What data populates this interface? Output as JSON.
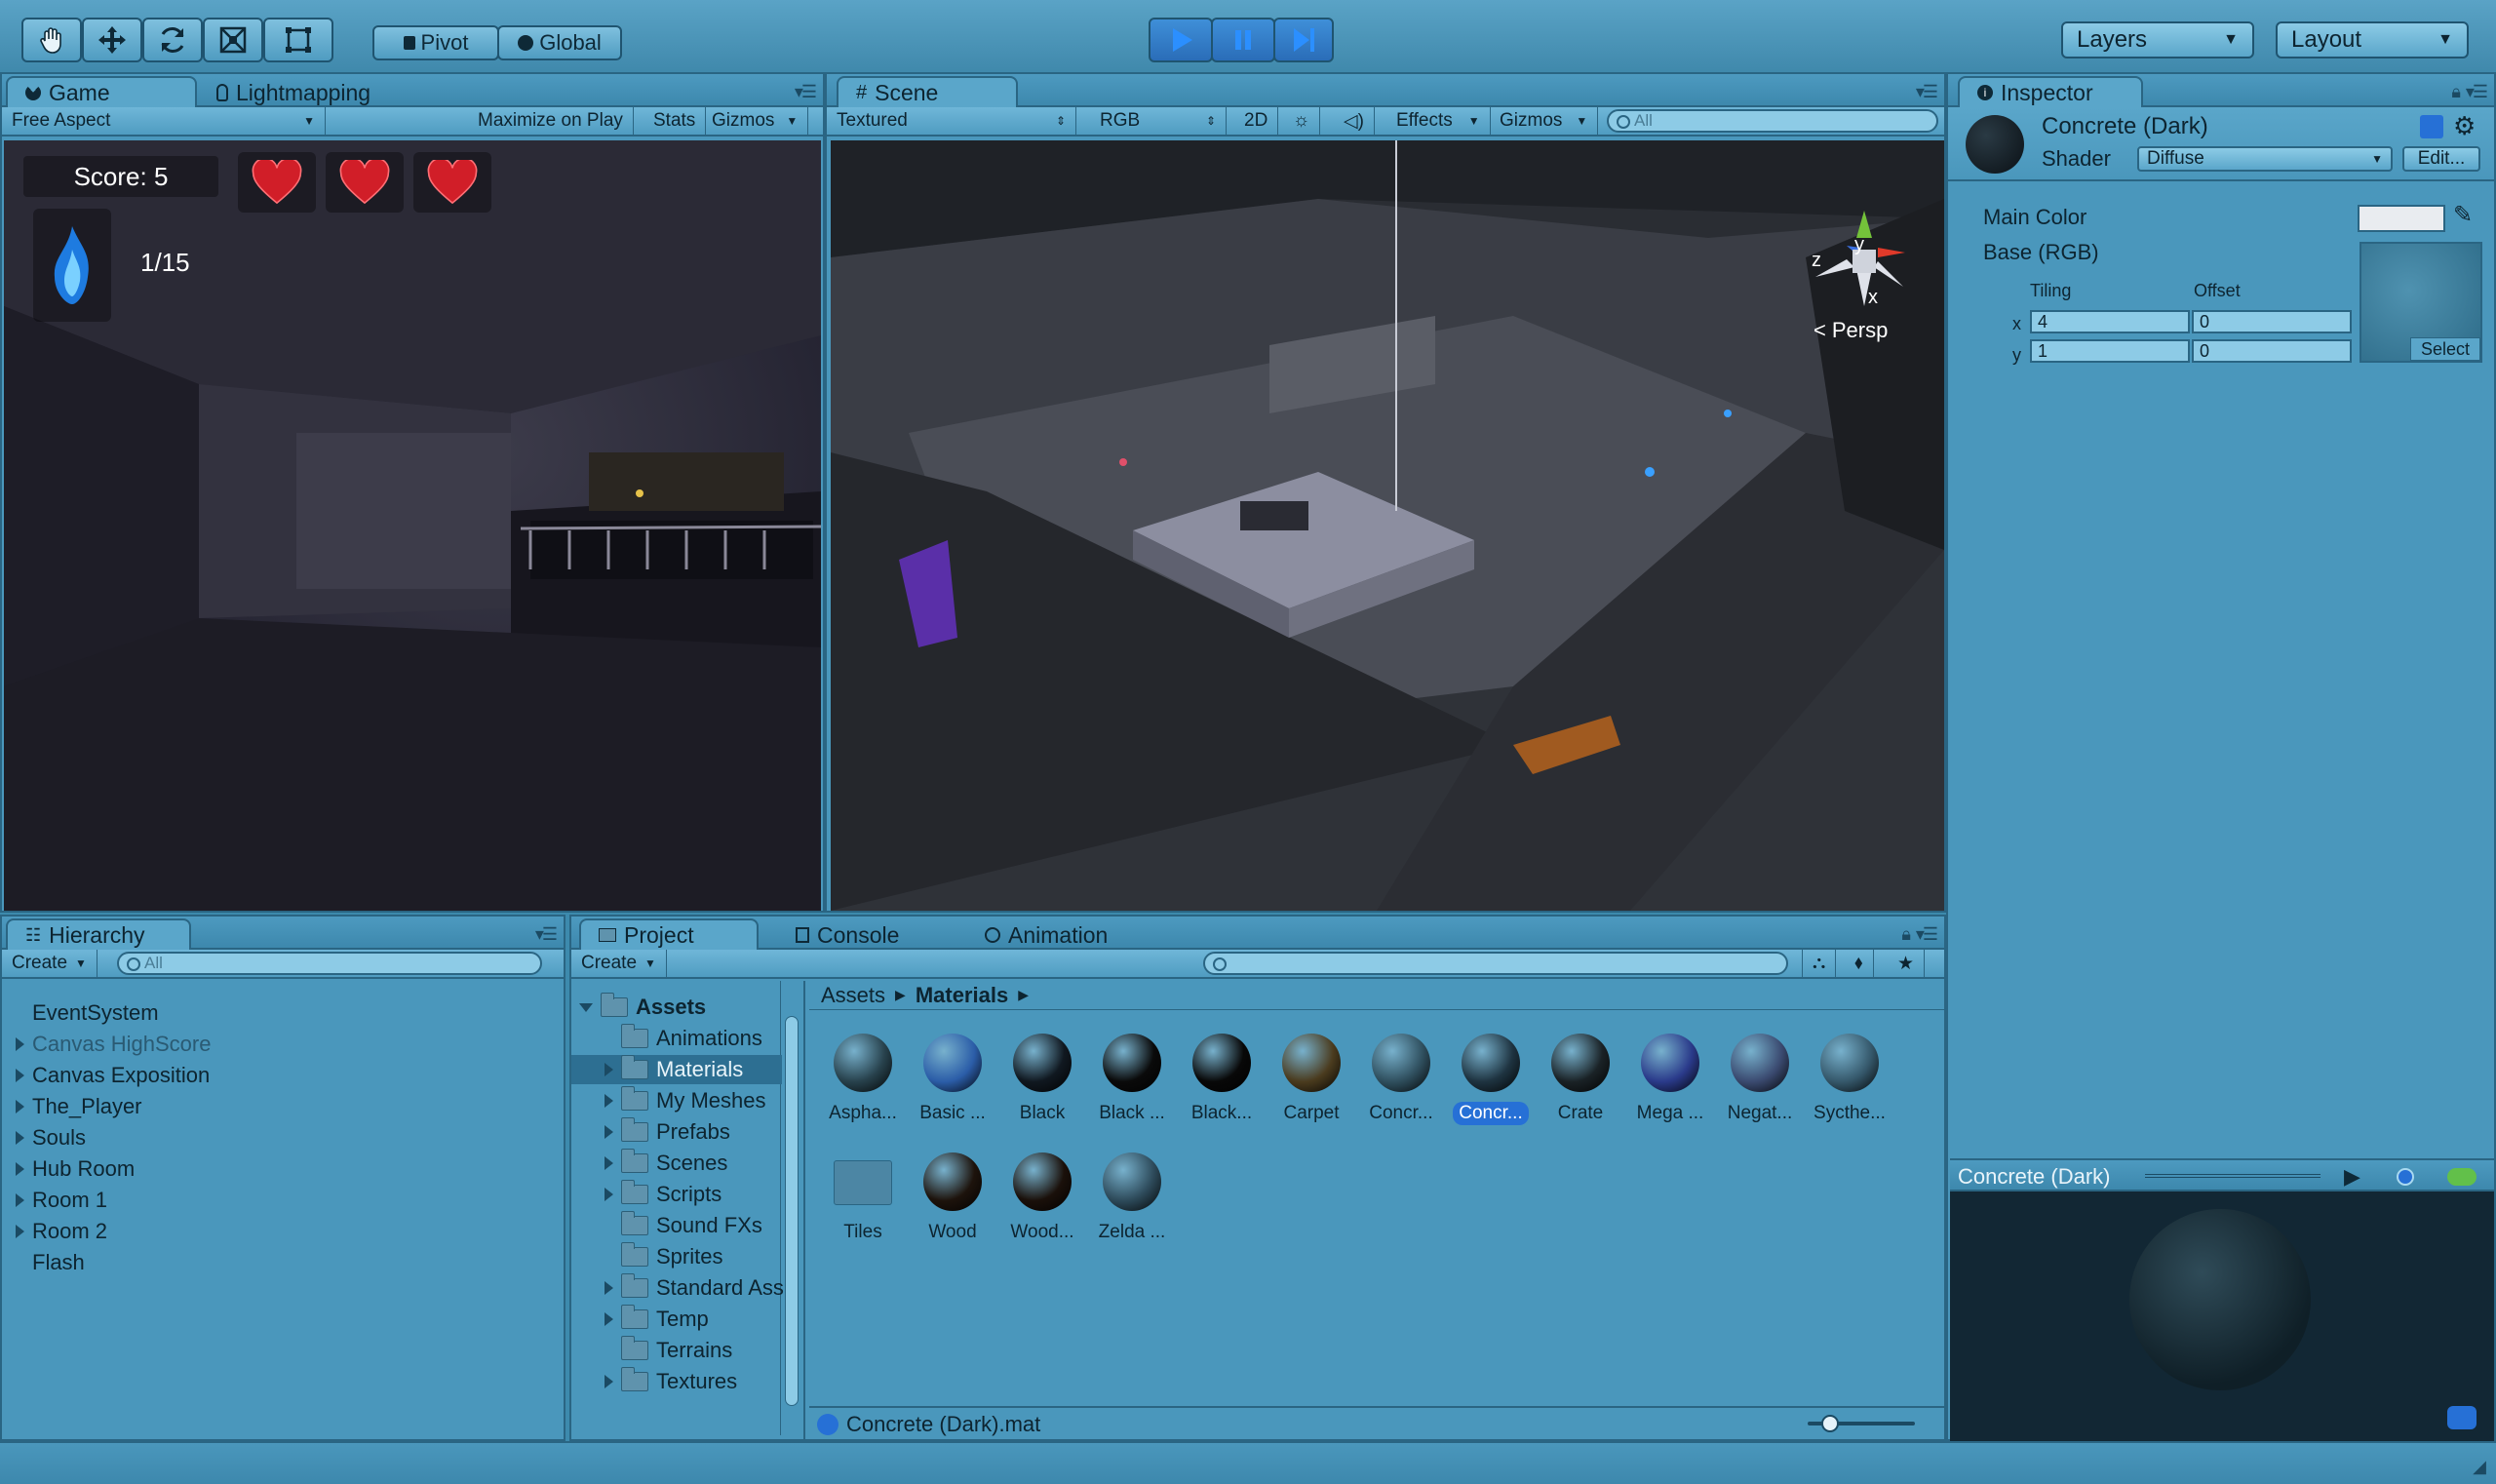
{
  "toolbar": {
    "pivot_label": "Pivot",
    "global_label": "Global",
    "layers_label": "Layers",
    "layout_label": "Layout"
  },
  "game_panel": {
    "tab_game": "Game",
    "tab_lightmapping": "Lightmapping",
    "aspect": "Free Aspect",
    "maximize": "Maximize on Play",
    "stats": "Stats",
    "gizmos": "Gizmos",
    "score": "Score: 5",
    "souls": "1/15"
  },
  "scene_panel": {
    "tab": "Scene",
    "render_mode": "Textured",
    "color_mode": "RGB",
    "mode_2d": "2D",
    "effects": "Effects",
    "gizmos": "Gizmos",
    "search_placeholder": "All",
    "persp": "Persp",
    "axis_x": "x",
    "axis_y": "y",
    "axis_z": "z"
  },
  "inspector": {
    "tab": "Inspector",
    "material_name": "Concrete (Dark)",
    "shader_label": "Shader",
    "shader_value": "Diffuse",
    "edit_label": "Edit...",
    "main_color": "Main Color",
    "base_rgb": "Base (RGB)",
    "tiling": "Tiling",
    "offset": "Offset",
    "x_label": "x",
    "y_label": "y",
    "tiling_x": "4",
    "tiling_y": "1",
    "offset_x": "0",
    "offset_y": "0",
    "select_label": "Select",
    "preview_title": "Concrete (Dark)"
  },
  "hierarchy": {
    "tab": "Hierarchy",
    "create": "Create",
    "search_placeholder": "All",
    "items": [
      {
        "label": "EventSystem",
        "expandable": false,
        "dim": false
      },
      {
        "label": "Canvas HighScore",
        "expandable": true,
        "dim": true
      },
      {
        "label": "Canvas Exposition",
        "expandable": true,
        "dim": false
      },
      {
        "label": "The_Player",
        "expandable": true,
        "dim": false
      },
      {
        "label": "Souls",
        "expandable": true,
        "dim": false
      },
      {
        "label": "Hub Room",
        "expandable": true,
        "dim": false
      },
      {
        "label": "Room 1",
        "expandable": true,
        "dim": false
      },
      {
        "label": "Room 2",
        "expandable": true,
        "dim": false
      },
      {
        "label": "Flash",
        "expandable": false,
        "dim": false
      }
    ]
  },
  "project": {
    "tab_project": "Project",
    "tab_console": "Console",
    "tab_animation": "Animation",
    "create": "Create",
    "breadcrumb_root": "Assets",
    "breadcrumb_current": "Materials",
    "tree_root": "Assets",
    "tree": [
      {
        "label": "Animations",
        "expandable": false
      },
      {
        "label": "Materials",
        "expandable": true,
        "selected": true
      },
      {
        "label": "My Meshes",
        "expandable": true
      },
      {
        "label": "Prefabs",
        "expandable": true
      },
      {
        "label": "Scenes",
        "expandable": true
      },
      {
        "label": "Scripts",
        "expandable": true
      },
      {
        "label": "Sound FXs",
        "expandable": false
      },
      {
        "label": "Sprites",
        "expandable": false
      },
      {
        "label": "Standard Ass",
        "expandable": true
      },
      {
        "label": "Temp",
        "expandable": true
      },
      {
        "label": "Terrains",
        "expandable": false
      },
      {
        "label": "Textures",
        "expandable": true
      }
    ],
    "assets": [
      {
        "label": "Aspha...",
        "color": "#27414c"
      },
      {
        "label": "Basic ...",
        "color": "#2b5da8"
      },
      {
        "label": "Black",
        "color": "#101820"
      },
      {
        "label": "Black ...",
        "color": "#0a0a0a"
      },
      {
        "label": "Black...",
        "color": "#080808"
      },
      {
        "label": "Carpet",
        "color": "#4a3b1e"
      },
      {
        "label": "Concr...",
        "color": "#2f4f5e"
      },
      {
        "label": "Concr...",
        "color": "#1e3340",
        "selected": true
      },
      {
        "label": "Crate",
        "color": "#1a2226"
      },
      {
        "label": "Mega ...",
        "color": "#2a3a8a"
      },
      {
        "label": "Negat...",
        "color": "#3a4a70"
      },
      {
        "label": "Sycthe...",
        "color": "#35586b"
      },
      {
        "label": "Tiles",
        "color": "#4c86a4",
        "folder": true
      },
      {
        "label": "Wood",
        "color": "#1d130c"
      },
      {
        "label": "Wood...",
        "color": "#1a100a"
      },
      {
        "label": "Zelda ...",
        "color": "#2d4a5a"
      }
    ],
    "status_file": "Concrete (Dark).mat"
  }
}
